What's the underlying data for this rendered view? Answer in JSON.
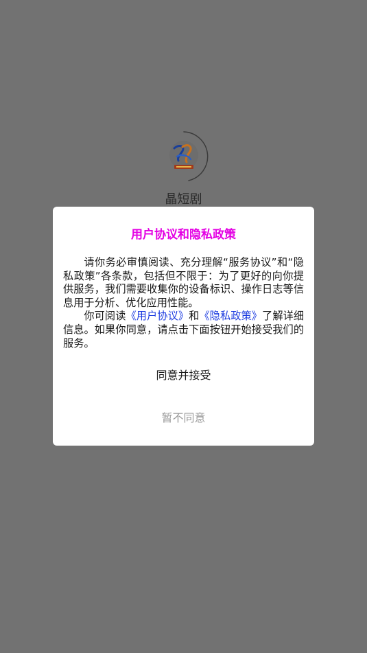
{
  "app": {
    "name": "晶短剧"
  },
  "dialog": {
    "title": "用户协议和隐私政策",
    "paragraph1": "请你务必审慎阅读、充分理解“服务协议”和“隐私政策”各条款，包括但不限于：为了更好的向你提供服务，我们需要收集你的设备标识、操作日志等信息用于分析、优化应用性能。",
    "paragraph2_prefix": "你可阅读",
    "user_agreement_link": "《用户协议》",
    "paragraph2_and": "和",
    "privacy_policy_link": "《隐私政策》",
    "paragraph2_suffix": "了解详细信息。如果你同意，请点击下面按钮开始接受我们的服务。",
    "agree_button": "同意并接受",
    "disagree_button": "暂不同意"
  },
  "colors": {
    "overlay_background": "#727272",
    "title": "#e400e4",
    "link": "#1d3ce0",
    "secondary_button": "#999999"
  },
  "icons": {
    "app_logo": "app-logo-icon",
    "loading_arc": "loading-spinner-icon"
  }
}
